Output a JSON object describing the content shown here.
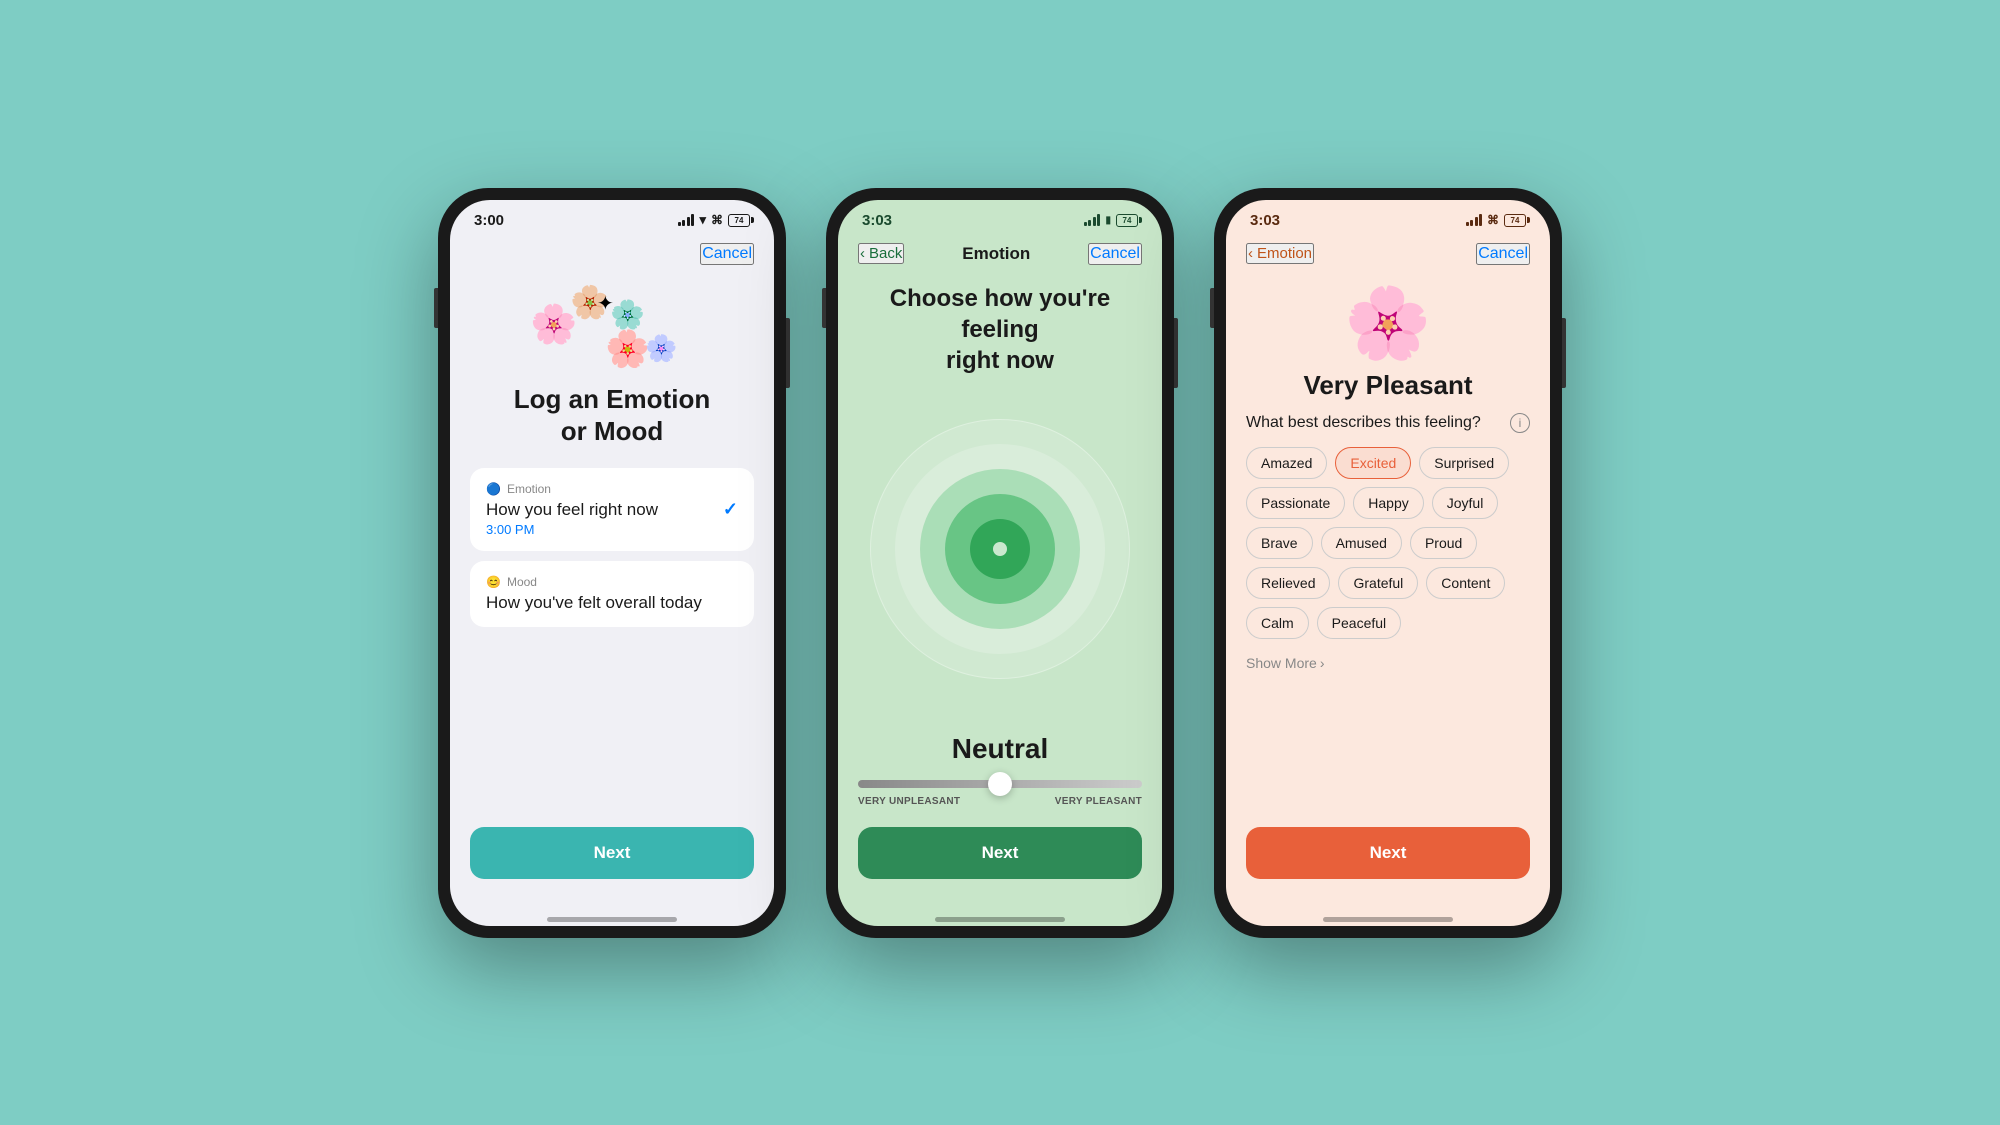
{
  "background_color": "#7ecdc4",
  "phones": [
    {
      "id": "phone1",
      "status_bar": {
        "time": "3:00",
        "battery": "74"
      },
      "header": {
        "cancel_label": "Cancel"
      },
      "screen_bg": "#f0f0f5",
      "title": "Log an Emotion\nor Mood",
      "options": [
        {
          "icon": "🔵",
          "label": "Emotion",
          "description": "How you feel right now",
          "time": "3:00 PM",
          "selected": true
        },
        {
          "icon": "😊",
          "label": "Mood",
          "description": "How you've felt overall today",
          "selected": false
        }
      ],
      "next_label": "Next",
      "next_color": "#3ab5b0"
    },
    {
      "id": "phone2",
      "status_bar": {
        "time": "3:03",
        "battery": "74"
      },
      "nav": {
        "back_label": "Back",
        "title": "Emotion",
        "cancel_label": "Cancel"
      },
      "screen_bg": "#c8e6c9",
      "title": "Choose how you're feeling\nright now",
      "emotion_label": "Neutral",
      "slider": {
        "position": 50,
        "left_label": "VERY UNPLEASANT",
        "right_label": "VERY PLEASANT"
      },
      "next_label": "Next",
      "next_color": "#2e8b57"
    },
    {
      "id": "phone3",
      "status_bar": {
        "time": "3:03",
        "battery": "74"
      },
      "nav": {
        "back_label": "Emotion",
        "cancel_label": "Cancel"
      },
      "screen_bg": "#fce8de",
      "pleasant_title": "Very Pleasant",
      "describe_question": "What best describes this feeling?",
      "tags": [
        {
          "label": "Amazed",
          "selected": false
        },
        {
          "label": "Excited",
          "selected": true
        },
        {
          "label": "Surprised",
          "selected": false
        },
        {
          "label": "Passionate",
          "selected": false
        },
        {
          "label": "Happy",
          "selected": false
        },
        {
          "label": "Joyful",
          "selected": false
        },
        {
          "label": "Brave",
          "selected": false
        },
        {
          "label": "Amused",
          "selected": false
        },
        {
          "label": "Proud",
          "selected": false
        },
        {
          "label": "Relieved",
          "selected": false
        },
        {
          "label": "Grateful",
          "selected": false
        },
        {
          "label": "Content",
          "selected": false
        },
        {
          "label": "Calm",
          "selected": false
        },
        {
          "label": "Peaceful",
          "selected": false
        }
      ],
      "show_more_label": "Show More",
      "next_label": "Next",
      "next_color": "#e8603a"
    }
  ]
}
